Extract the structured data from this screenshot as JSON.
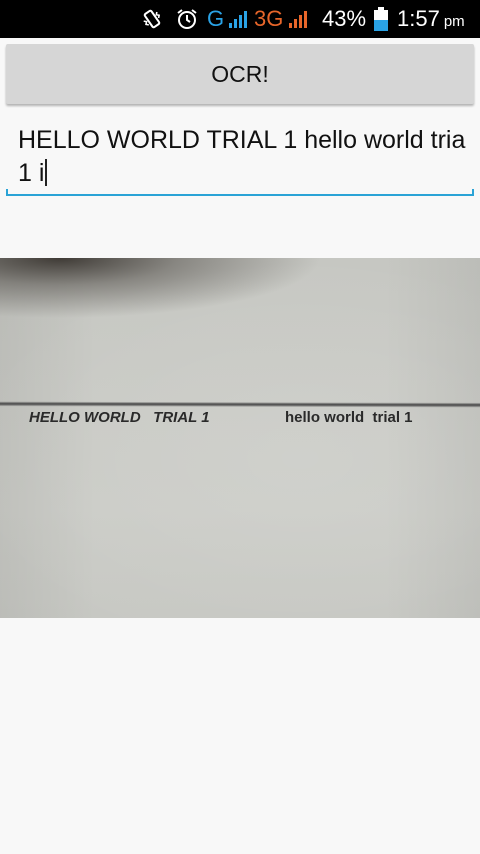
{
  "status_bar": {
    "network_g": "G",
    "network_3g": "3G",
    "battery_percent": "43%",
    "time": "1:57",
    "ampm": "pm",
    "icons": [
      "vibrate-icon",
      "alarm-icon",
      "signal-icon",
      "signal-icon",
      "battery-icon"
    ],
    "colors": {
      "g": "#2aa3e6",
      "3g": "#e8662a"
    }
  },
  "ocr_button": {
    "label": "OCR!"
  },
  "ocr_field": {
    "value": "HELLO WORLD TRIAL 1 hello world tria 1 i"
  },
  "photo": {
    "text_upper": "HELLO WORLD   TRIAL 1",
    "text_lower": "hello world  trial 1"
  },
  "colors": {
    "accent": "#2aa3d6",
    "background": "#f8f8f8",
    "button": "#d6d6d6"
  }
}
